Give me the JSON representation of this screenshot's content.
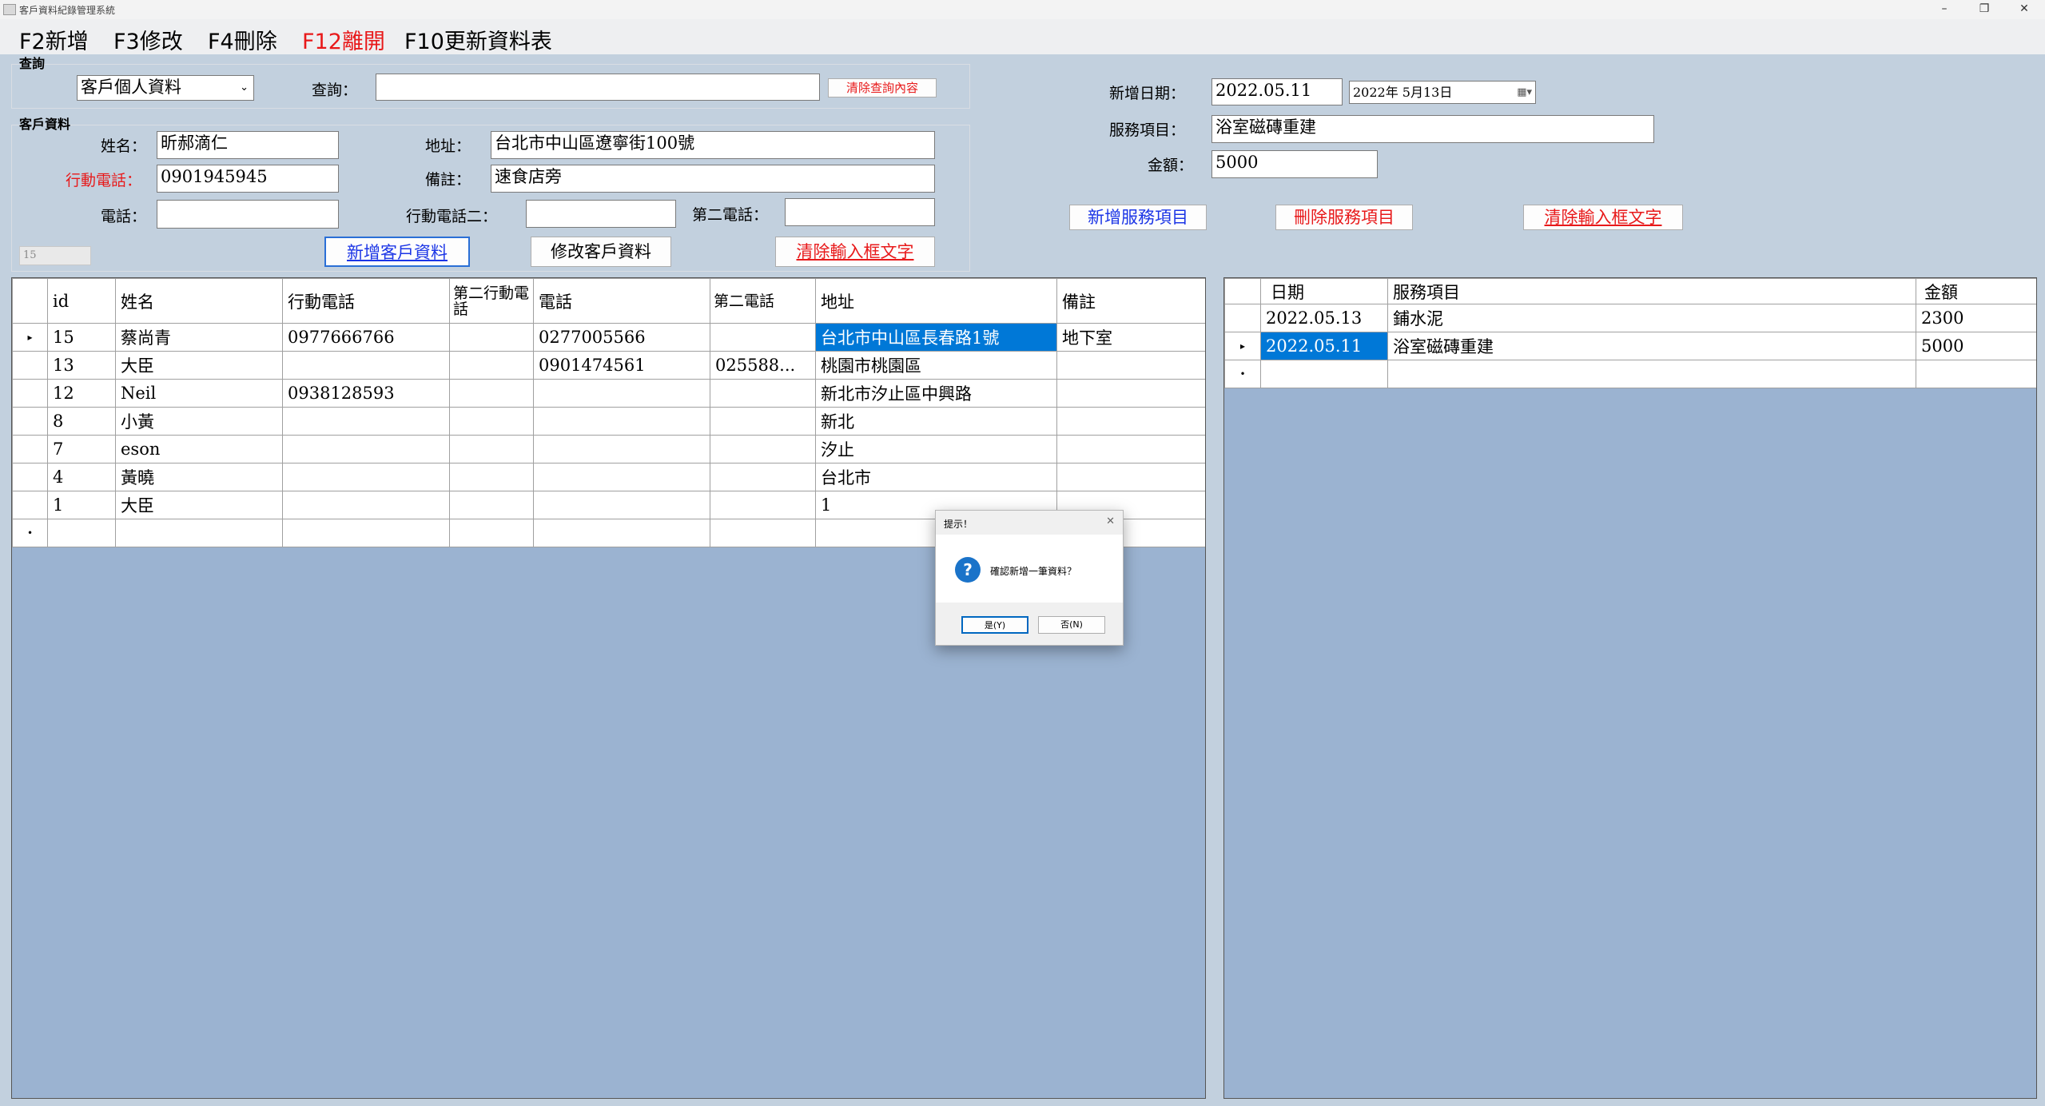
{
  "window": {
    "title": "客戶資料紀錄管理系統",
    "minimize": "–",
    "restore": "❐",
    "close": "✕"
  },
  "menu": {
    "add": "F2新增",
    "edit": "F3修改",
    "delete": "F4刪除",
    "exit": "F12離開",
    "refresh": "F10更新資料表"
  },
  "colors": {
    "exit_menu": "#e8191a",
    "required_label": "#e8191a",
    "blue_button": "#1b35e6",
    "red_button": "#e8191a",
    "selection": "#0078d7"
  },
  "query": {
    "group_title": "查詢",
    "type_value": "客戶個人資料",
    "label": "查詢：",
    "value": "",
    "clear_button": "清除查詢內容"
  },
  "customer": {
    "group_title": "客戶資料",
    "name_label": "姓名：",
    "name_value": "昕郝滴仁",
    "mobile_label": "行動電話：",
    "mobile_value": "0901945945",
    "phone_label": "電話：",
    "phone_value": "",
    "address_label": "地址：",
    "address_value": "台北市中山區遼寧街100號",
    "note_label": "備註：",
    "note_value": "速食店旁",
    "mobile2_label": "行動電話二：",
    "mobile2_value": "",
    "phone2_label": "第二電話：",
    "phone2_value": "",
    "id_value": "15",
    "add_button": "新增客戶資料",
    "edit_button": "修改客戶資料",
    "clear_button": "清除輸入框文字"
  },
  "service": {
    "date_label": "新增日期：",
    "date_value": "2022.05.11",
    "picker_value": "2022年  5月13日",
    "item_label": "服務項目：",
    "item_value": "浴室磁磚重建",
    "amount_label": "金額：",
    "amount_value": "5000",
    "add_button": "新增服務項目",
    "delete_button": "刪除服務項目",
    "clear_button": "清除輸入框文字"
  },
  "customers_table": {
    "columns": [
      "id",
      "姓名",
      "行動電話",
      "第二行動電話",
      "電話",
      "第二電話",
      "地址",
      "備註"
    ],
    "rows": [
      [
        "15",
        "蔡尚青",
        "0977666766",
        "",
        "0277005566",
        "",
        "台北市中山區長春路1號",
        "地下室"
      ],
      [
        "13",
        "大臣",
        "",
        "",
        "0901474561",
        "025588...",
        "桃園市桃園區",
        ""
      ],
      [
        "12",
        "Neil",
        "0938128593",
        "",
        "",
        "",
        "新北市汐止區中興路",
        ""
      ],
      [
        "8",
        "小黃",
        "",
        "",
        "",
        "",
        "新北",
        ""
      ],
      [
        "7",
        "eson",
        "",
        "",
        "",
        "",
        "汐止",
        ""
      ],
      [
        "4",
        "黃曉",
        "",
        "",
        "",
        "",
        "台北市",
        ""
      ],
      [
        "1",
        "大臣",
        "",
        "",
        "",
        "",
        "1",
        ""
      ]
    ]
  },
  "services_table": {
    "columns": [
      "日期",
      "服務項目",
      "金額"
    ],
    "rows": [
      [
        "2022.05.13",
        "鋪水泥",
        "2300"
      ],
      [
        "2022.05.11",
        "浴室磁磚重建",
        "5000"
      ]
    ]
  },
  "dialog": {
    "title": "提示！",
    "close": "✕",
    "icon": "question-icon",
    "message": "確認新增一筆資料？",
    "yes": "是(Y)",
    "no": "否(N)"
  }
}
